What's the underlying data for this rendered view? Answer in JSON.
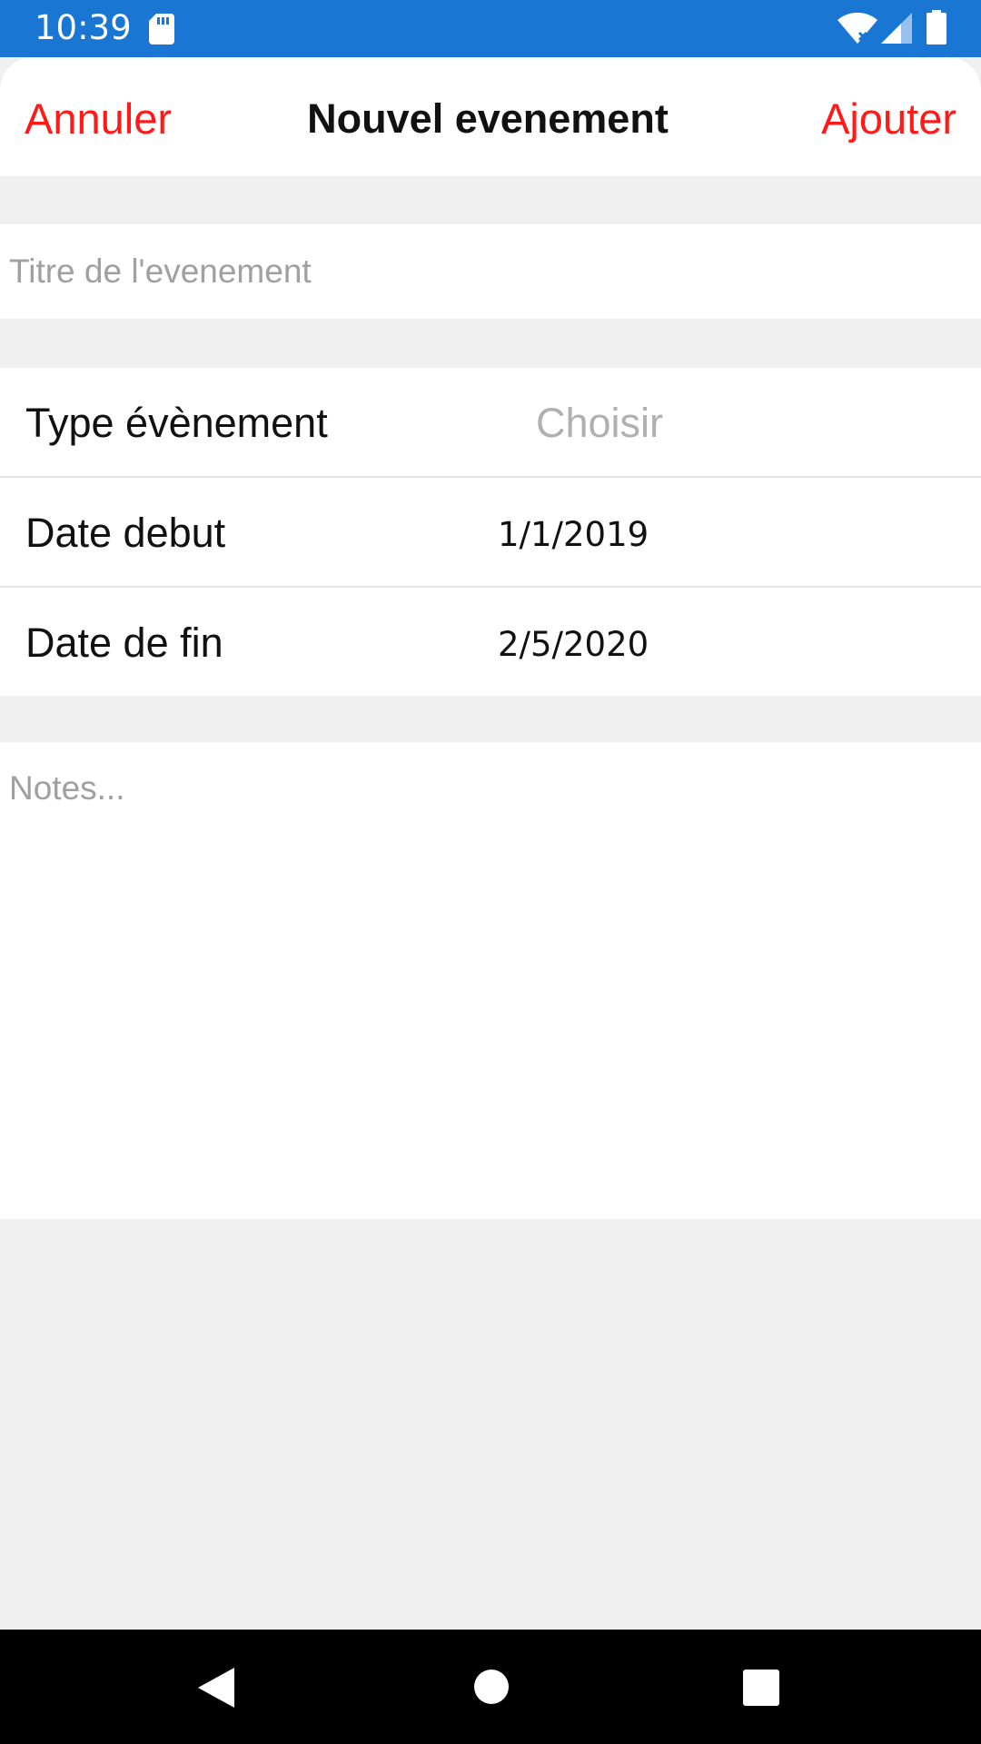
{
  "status_bar": {
    "time": "10:39",
    "icons": [
      "sd-card-icon",
      "wifi-icon",
      "signal-icon",
      "battery-icon"
    ],
    "color": "#1976d2"
  },
  "header": {
    "cancel_label": "Annuler",
    "title": "Nouvel evenement",
    "add_label": "Ajouter",
    "accent_color": "#ff1a1a"
  },
  "title_field": {
    "placeholder": "Titre de l'evenement",
    "value": ""
  },
  "rows": {
    "event_type": {
      "label": "Type évènement",
      "value": "Choisir"
    },
    "start_date": {
      "label": "Date debut",
      "value": "1/1/2019"
    },
    "end_date": {
      "label": "Date de fin",
      "value": "2/5/2020"
    }
  },
  "notes": {
    "placeholder": "Notes...",
    "value": ""
  },
  "nav_bar": {
    "icons": [
      "back-icon",
      "home-icon",
      "recent-apps-icon"
    ]
  }
}
